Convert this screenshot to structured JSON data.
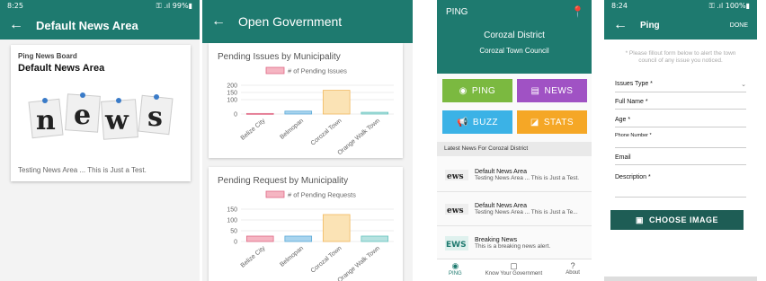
{
  "screen1": {
    "status_time": "8:25",
    "status_right": "⚿ .ıl 99%▮",
    "title": "Default News Area",
    "card": {
      "board": "Ping News Board",
      "title": "Default News Area",
      "image_letters": [
        "n",
        "e",
        "w",
        "s"
      ],
      "footer": "Testing News Area ... This is Just a Test."
    }
  },
  "screen2": {
    "title": "Open Government",
    "charts": [
      {
        "title": "Pending Issues by Municipality",
        "legend": "# of Pending Issues",
        "chart_data": {
          "type": "bar",
          "categories": [
            "Belize City",
            "Belmopan",
            "Corozal Town",
            "Orange Walk Town"
          ],
          "values": [
            4,
            20,
            165,
            12
          ],
          "ylim": [
            0,
            200
          ],
          "yticks": [
            0,
            100,
            150,
            200
          ],
          "colors": [
            "#f5b5c2",
            "#a8d4ee",
            "#fbe3b5",
            "#b6e2e0"
          ]
        }
      },
      {
        "title": "Pending Request by Municipality",
        "legend": "# of Pending Requests",
        "chart_data": {
          "type": "bar",
          "categories": [
            "Belize City",
            "Belmopan",
            "Corozal Town",
            "Orange Walk Town"
          ],
          "values": [
            25,
            25,
            125,
            25
          ],
          "ylim": [
            0,
            150
          ],
          "yticks": [
            0,
            50,
            100,
            150
          ],
          "colors": [
            "#f5b5c2",
            "#a8d4ee",
            "#fbe3b5",
            "#b6e2e0"
          ]
        }
      }
    ]
  },
  "screen3": {
    "app_label": "PING",
    "district": "Corozal District",
    "council": "Corozal Town Council",
    "tiles": [
      {
        "label": "PING",
        "icon": "◉",
        "color": "#7bb940"
      },
      {
        "label": "NEWS",
        "icon": "▤",
        "color": "#a052c4"
      },
      {
        "label": "BUZZ",
        "icon": "📢",
        "color": "#3bb2e6"
      },
      {
        "label": "STATS",
        "icon": "◪",
        "color": "#f5a726"
      }
    ],
    "latest_header": "Latest News For Corozal District",
    "news": [
      {
        "title": "Default News Area",
        "desc": "Testing News Area ... This is Just a Test."
      },
      {
        "title": "Default News Area",
        "desc": "Testing News Area ... This is Just a Te..."
      },
      {
        "title": "Breaking News",
        "desc": "This is a breaking news alert."
      }
    ],
    "nav": [
      {
        "label": "PING",
        "icon": "◉"
      },
      {
        "label": "Know Your Government",
        "icon": "▢"
      },
      {
        "label": "About",
        "icon": "?"
      }
    ]
  },
  "screen4": {
    "status_time": "8:24",
    "status_right": "⚿ .ıl 100%▮",
    "title": "Ping",
    "done": "DONE",
    "hint": "* Please fillout form below to alert the town council of any issue you noticed.",
    "fields": {
      "issue_type": "Issues Type *",
      "full_name": "Full Name *",
      "age": "Age *",
      "phone": "Phone Number *",
      "email": "Email",
      "description": "Description *"
    },
    "choose_image": "CHOOSE IMAGE"
  }
}
